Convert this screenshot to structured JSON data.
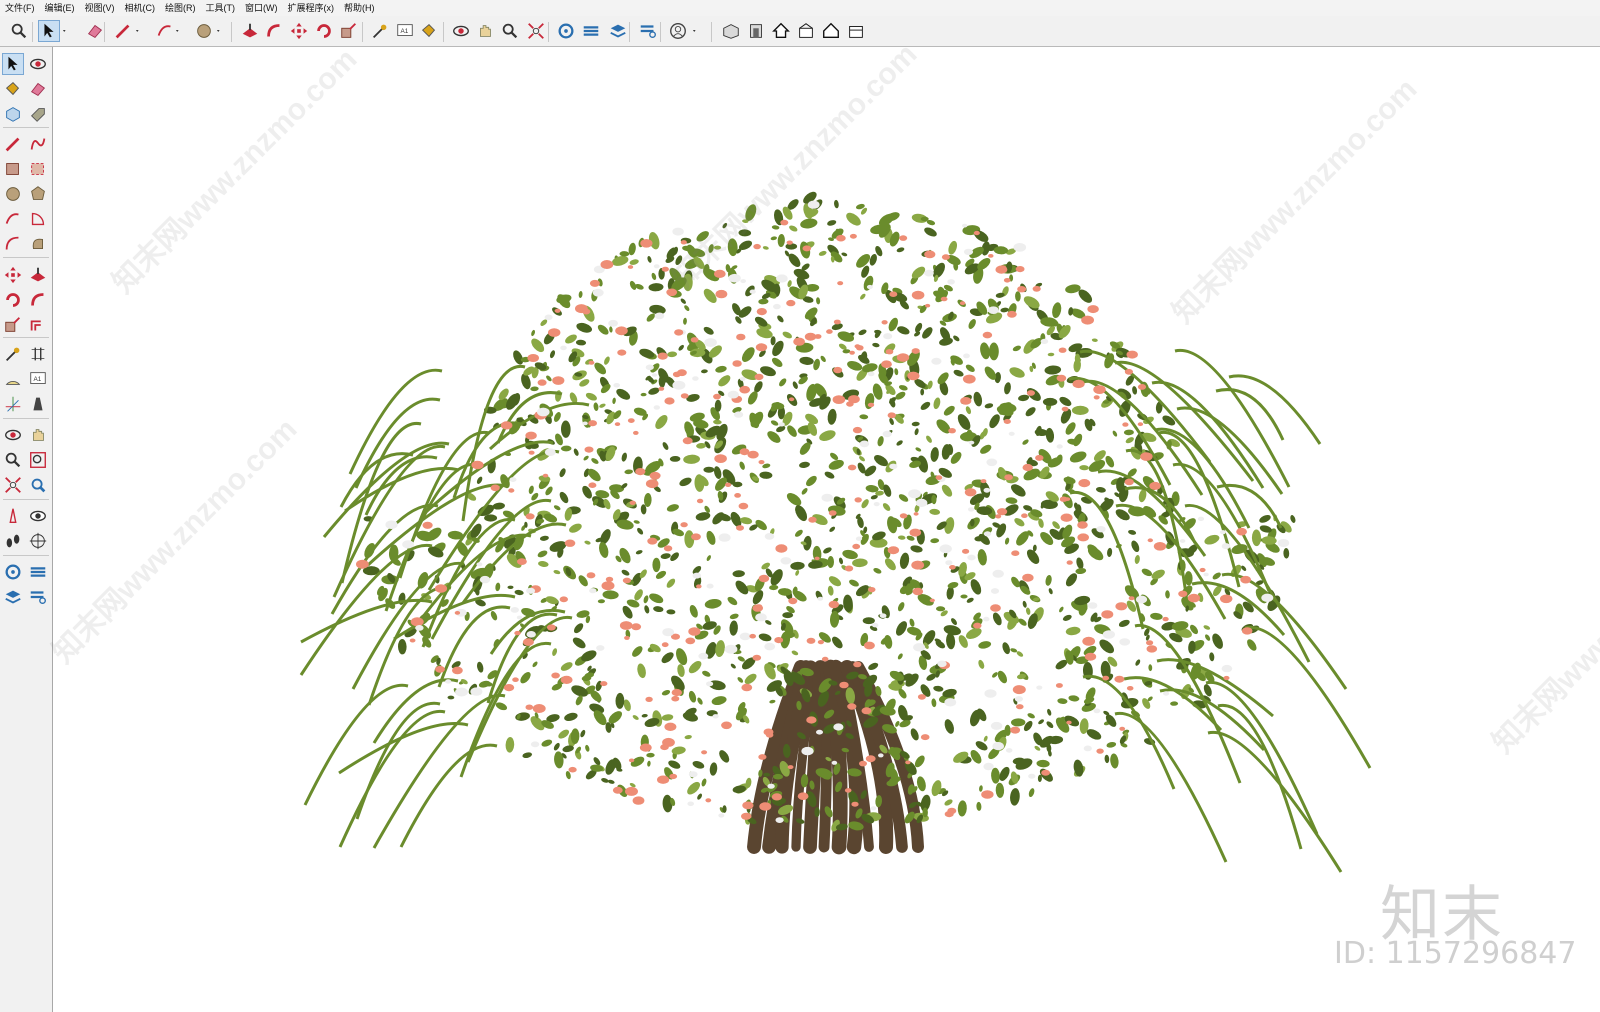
{
  "menu": [
    "文件(F)",
    "编辑(E)",
    "视图(V)",
    "相机(C)",
    "绘图(R)",
    "工具(T)",
    "窗口(W)",
    "扩展程序(x)",
    "帮助(H)"
  ],
  "toolbar_icons": [
    "zoom-icon",
    "select-icon",
    "dropdown-icon",
    "eraser-icon",
    "pencil-icon",
    "dropdown-icon",
    "arc-icon",
    "dropdown-icon",
    "circle-icon",
    "dropdown-icon",
    "push-pull-icon",
    "follow-me-icon",
    "move-icon",
    "rotate-icon",
    "scale-icon",
    "tape-measure-icon",
    "text-icon",
    "paint-bucket-icon",
    "orbit-icon",
    "pan-icon",
    "zoom-icon",
    "zoom-extents-icon",
    "3d-warehouse-icon",
    "extension-warehouse-icon",
    "layout-icon",
    "extension-manager-icon",
    "account-icon",
    "dropdown-icon",
    "iso-view-icon",
    "front-view-icon",
    "top-view-icon",
    "right-view-icon",
    "back-view-icon",
    "left-view-icon"
  ],
  "side_tools": [
    "select-icon",
    "orbit-icon",
    "paint-bucket-icon",
    "eraser-icon",
    "component-icon",
    "tag-icon",
    "pencil-icon",
    "freehand-icon",
    "rectangle-icon",
    "rotated-rectangle-icon",
    "circle-icon",
    "polygon-icon",
    "arc-icon",
    "pie-icon",
    "two-point-arc-icon",
    "three-point-arc-icon",
    "move-icon",
    "push-pull-icon",
    "rotate-icon",
    "follow-me-icon",
    "scale-icon",
    "offset-icon",
    "tape-measure-icon",
    "dimension-icon",
    "protractor-icon",
    "text-icon",
    "axes-icon",
    "3d-text-icon",
    "orbit-icon",
    "pan-icon",
    "zoom-icon",
    "zoom-window-icon",
    "zoom-extents-icon",
    "previous-view-icon",
    "position-camera-icon",
    "look-around-icon",
    "walk-icon",
    "section-plane-icon",
    "3d-warehouse-icon",
    "extension-warehouse-icon",
    "layout-icon",
    "extension-manager-icon"
  ],
  "watermark": {
    "logo": "知末",
    "id": "ID: 1157296847"
  },
  "watermark_text": "知末网www.znzmo.com",
  "colors": {
    "leaf_dark": "#4a6420",
    "leaf": "#6a8c2c",
    "leaf_light": "#8aa844",
    "blossom": "#ee8d75",
    "blossom_white": "#eeeeee",
    "trunk": "#5a4530"
  }
}
